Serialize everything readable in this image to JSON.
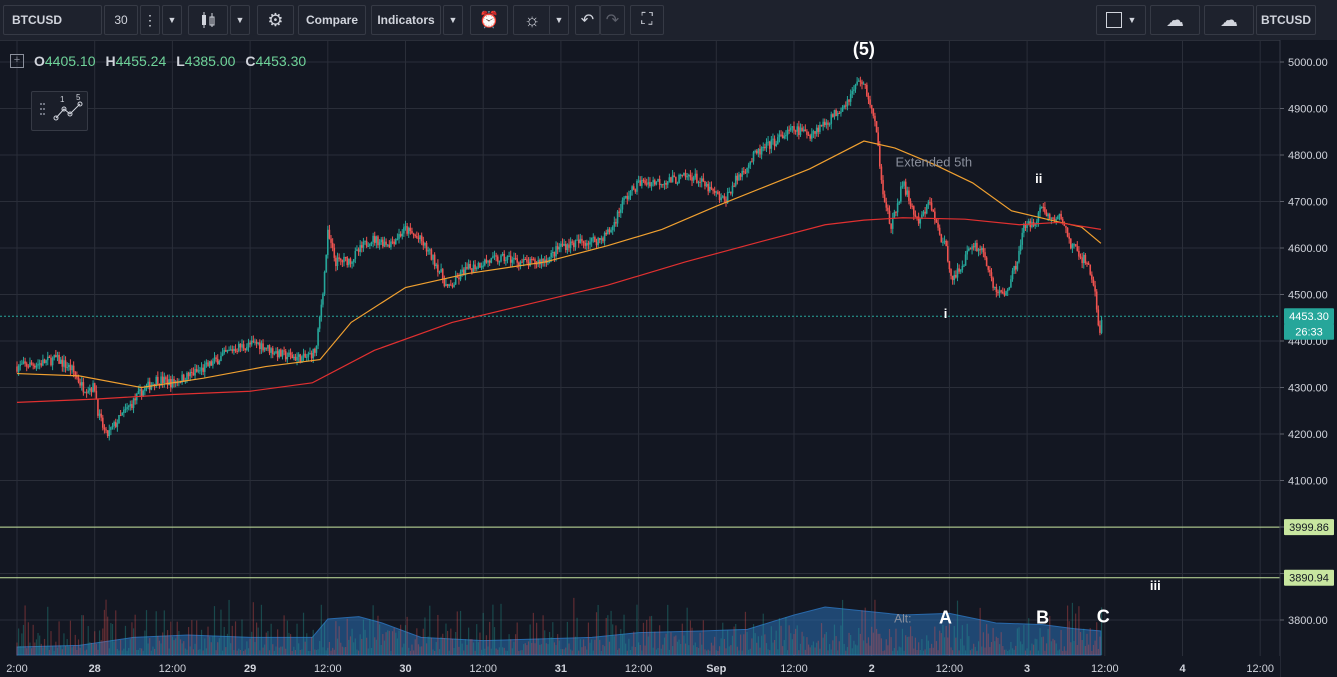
{
  "toolbar": {
    "symbol": "BTCUSD",
    "interval": "30",
    "compare_label": "Compare",
    "indicators_label": "Indicators",
    "right_symbol": "BTCUSD"
  },
  "ohlc": {
    "open_key": "O",
    "open": "4405.10",
    "high_key": "H",
    "high": "4455.24",
    "low_key": "L",
    "low": "4385.00",
    "close_key": "C",
    "close": "4453.30"
  },
  "wave_tool_labels": [
    "1",
    "5"
  ],
  "chart_data": {
    "type": "candlestick",
    "symbol": "BTCUSD",
    "interval_minutes": 30,
    "y_axis": {
      "ticks": [
        3800,
        3900,
        4000,
        4100,
        4200,
        4300,
        4400,
        4500,
        4600,
        4700,
        4800,
        4900,
        5000
      ],
      "tick_labels": [
        "3800.00",
        "3900.00",
        "4000.00",
        "4100.00",
        "4200.00",
        "4300.00",
        "4400.00",
        "4500.00",
        "4600.00",
        "4700.00",
        "4800.00",
        "4900.00",
        "5000.00"
      ],
      "range": [
        3725,
        5050
      ]
    },
    "x_axis": {
      "ticks": [
        0,
        1,
        2,
        3,
        4,
        5,
        6,
        7,
        8,
        9,
        10,
        11,
        12,
        13,
        14,
        15,
        16
      ],
      "tick_labels": [
        "2:00",
        "28",
        "12:00",
        "29",
        "12:00",
        "30",
        "12:00",
        "31",
        "12:00",
        "Sep",
        "12:00",
        "2",
        "12:00",
        "3",
        "12:00",
        "4",
        "12:00"
      ],
      "range": [
        0,
        16.6
      ]
    },
    "price_markers": [
      {
        "label": "4453.30",
        "value": 4453.3,
        "color": "#26a69a",
        "line": "dotted"
      },
      {
        "label": "26:33",
        "value": 4420,
        "color": "#26a69a",
        "line": "none"
      },
      {
        "label": "3999.86",
        "value": 3999.86,
        "color": "#c8e6a0",
        "line": "solid"
      },
      {
        "label": "3890.94",
        "value": 3890.94,
        "color": "#c8e6a0",
        "line": "solid"
      }
    ],
    "price_path": [
      [
        0.0,
        4345
      ],
      [
        0.3,
        4352
      ],
      [
        0.5,
        4362
      ],
      [
        0.7,
        4340
      ],
      [
        0.85,
        4300
      ],
      [
        1.0,
        4300
      ],
      [
        1.05,
        4240
      ],
      [
        1.15,
        4195
      ],
      [
        1.35,
        4240
      ],
      [
        1.6,
        4290
      ],
      [
        1.8,
        4318
      ],
      [
        2.0,
        4310
      ],
      [
        2.4,
        4340
      ],
      [
        2.8,
        4385
      ],
      [
        3.1,
        4395
      ],
      [
        3.4,
        4370
      ],
      [
        3.7,
        4362
      ],
      [
        3.85,
        4380
      ],
      [
        3.95,
        4530
      ],
      [
        4.0,
        4630
      ],
      [
        4.1,
        4570
      ],
      [
        4.3,
        4575
      ],
      [
        4.55,
        4620
      ],
      [
        4.8,
        4610
      ],
      [
        5.0,
        4640
      ],
      [
        5.2,
        4615
      ],
      [
        5.4,
        4565
      ],
      [
        5.55,
        4510
      ],
      [
        5.75,
        4550
      ],
      [
        6.0,
        4570
      ],
      [
        6.3,
        4578
      ],
      [
        6.6,
        4566
      ],
      [
        6.85,
        4578
      ],
      [
        7.0,
        4605
      ],
      [
        7.25,
        4612
      ],
      [
        7.5,
        4618
      ],
      [
        7.65,
        4640
      ],
      [
        7.8,
        4700
      ],
      [
        8.0,
        4740
      ],
      [
        8.4,
        4745
      ],
      [
        8.7,
        4755
      ],
      [
        8.95,
        4720
      ],
      [
        9.1,
        4700
      ],
      [
        9.25,
        4745
      ],
      [
        9.5,
        4800
      ],
      [
        9.8,
        4835
      ],
      [
        10.0,
        4855
      ],
      [
        10.2,
        4845
      ],
      [
        10.45,
        4875
      ],
      [
        10.7,
        4920
      ],
      [
        10.85,
        4965
      ],
      [
        10.95,
        4930
      ],
      [
        11.05,
        4860
      ],
      [
        11.15,
        4720
      ],
      [
        11.25,
        4640
      ],
      [
        11.4,
        4740
      ],
      [
        11.6,
        4650
      ],
      [
        11.75,
        4700
      ],
      [
        11.85,
        4640
      ],
      [
        11.95,
        4600
      ],
      [
        12.05,
        4530
      ],
      [
        12.15,
        4560
      ],
      [
        12.3,
        4610
      ],
      [
        12.45,
        4590
      ],
      [
        12.55,
        4520
      ],
      [
        12.7,
        4495
      ],
      [
        12.85,
        4560
      ],
      [
        12.95,
        4640
      ],
      [
        13.1,
        4660
      ],
      [
        13.2,
        4690
      ],
      [
        13.3,
        4660
      ],
      [
        13.45,
        4665
      ],
      [
        13.55,
        4610
      ],
      [
        13.7,
        4580
      ],
      [
        13.8,
        4560
      ],
      [
        13.88,
        4500
      ],
      [
        13.93,
        4410
      ],
      [
        13.97,
        4453
      ]
    ],
    "series": [
      {
        "name": "",
        "color": "#f0a030",
        "values": [
          [
            0.0,
            4330
          ],
          [
            0.8,
            4325
          ],
          [
            1.6,
            4300
          ],
          [
            2.4,
            4320
          ],
          [
            3.2,
            4345
          ],
          [
            3.9,
            4360
          ],
          [
            4.3,
            4440
          ],
          [
            5.0,
            4515
          ],
          [
            5.8,
            4545
          ],
          [
            6.8,
            4570
          ],
          [
            7.6,
            4605
          ],
          [
            8.3,
            4640
          ],
          [
            9.0,
            4690
          ],
          [
            9.6,
            4730
          ],
          [
            10.2,
            4770
          ],
          [
            10.9,
            4830
          ],
          [
            11.3,
            4815
          ],
          [
            11.8,
            4780
          ],
          [
            12.3,
            4740
          ],
          [
            12.8,
            4680
          ],
          [
            13.3,
            4660
          ],
          [
            13.7,
            4645
          ],
          [
            13.95,
            4610
          ]
        ]
      },
      {
        "name": "",
        "color": "#e03030",
        "values": [
          [
            0.0,
            4268
          ],
          [
            1.0,
            4275
          ],
          [
            2.0,
            4285
          ],
          [
            3.0,
            4292
          ],
          [
            3.8,
            4310
          ],
          [
            4.6,
            4380
          ],
          [
            5.6,
            4440
          ],
          [
            6.6,
            4480
          ],
          [
            7.6,
            4520
          ],
          [
            8.6,
            4570
          ],
          [
            9.6,
            4615
          ],
          [
            10.4,
            4650
          ],
          [
            10.9,
            4660
          ],
          [
            11.4,
            4665
          ],
          [
            12.2,
            4662
          ],
          [
            12.9,
            4650
          ],
          [
            13.4,
            4655
          ],
          [
            13.95,
            4640
          ]
        ]
      }
    ],
    "annotations": [
      {
        "text": "(5)",
        "x": 10.9,
        "y": 5015,
        "color": "#ffffff",
        "size": "lg"
      },
      {
        "text": "Extended 5th",
        "x": 11.8,
        "y": 4775,
        "color": "#8a8f9c",
        "size": "md"
      },
      {
        "text": "ii",
        "x": 13.15,
        "y": 4740,
        "color": "#ffffff",
        "size": "md"
      },
      {
        "text": "i",
        "x": 11.95,
        "y": 4450,
        "color": "#ffffff",
        "size": "md"
      },
      {
        "text": "iii",
        "x": 14.65,
        "y": 3865,
        "color": "#ffffff",
        "size": "md"
      },
      {
        "text": "Alt:",
        "x": 11.4,
        "y": 3795,
        "color": "#8a8f9c",
        "size": "sm"
      },
      {
        "text": "A",
        "x": 11.95,
        "y": 3793,
        "color": "#ffffff",
        "size": "lg"
      },
      {
        "text": "B",
        "x": 13.2,
        "y": 3793,
        "color": "#ffffff",
        "size": "lg"
      },
      {
        "text": "C",
        "x": 13.98,
        "y": 3795,
        "color": "#ffffff",
        "size": "lg"
      }
    ],
    "volume": {
      "color": "#2a6fb5",
      "values": [
        [
          0.0,
          0.1
        ],
        [
          0.8,
          0.12
        ],
        [
          1.5,
          0.22
        ],
        [
          2.2,
          0.25
        ],
        [
          3.0,
          0.22
        ],
        [
          3.8,
          0.22
        ],
        [
          4.0,
          0.45
        ],
        [
          4.4,
          0.48
        ],
        [
          4.7,
          0.4
        ],
        [
          5.2,
          0.22
        ],
        [
          6.0,
          0.18
        ],
        [
          6.7,
          0.2
        ],
        [
          7.4,
          0.22
        ],
        [
          8.0,
          0.28
        ],
        [
          8.8,
          0.3
        ],
        [
          9.4,
          0.32
        ],
        [
          10.0,
          0.5
        ],
        [
          10.4,
          0.6
        ],
        [
          10.9,
          0.55
        ],
        [
          11.4,
          0.5
        ],
        [
          12.0,
          0.52
        ],
        [
          12.6,
          0.4
        ],
        [
          13.2,
          0.38
        ],
        [
          13.6,
          0.33
        ],
        [
          13.95,
          0.3
        ]
      ]
    }
  },
  "colors": {
    "background": "#131722",
    "grid": "#2a2e39",
    "up": "#26a69a",
    "down": "#ef5350",
    "axis_text": "#d1d4dc"
  }
}
